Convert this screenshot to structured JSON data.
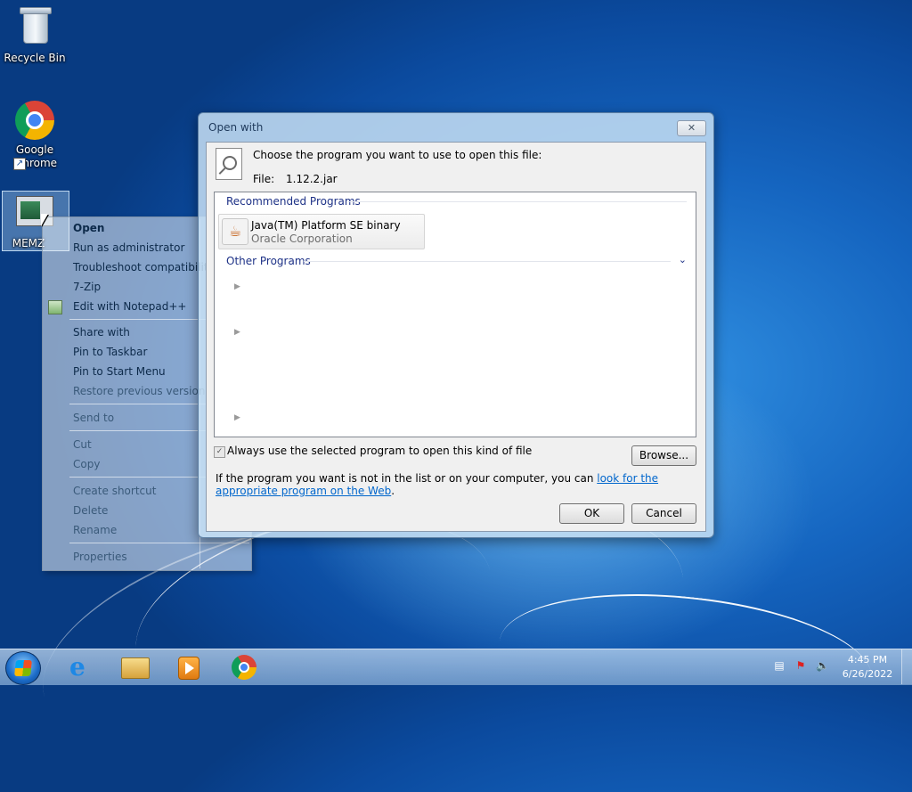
{
  "desktop": {
    "icons": [
      {
        "label": "Recycle Bin"
      },
      {
        "label": "Google Chrome"
      },
      {
        "label": "MEMZ"
      }
    ]
  },
  "context_menu": {
    "items": [
      "Open",
      "Run as administrator",
      "Troubleshoot compatibility",
      "7-Zip",
      "Edit with Notepad++",
      "Share with",
      "Pin to Taskbar",
      "Pin to Start Menu",
      "Restore previous versions",
      "Send to",
      "Cut",
      "Copy",
      "Create shortcut",
      "Delete",
      "Rename",
      "Properties"
    ]
  },
  "dialog": {
    "title": "Open with",
    "close_label": "✕",
    "prompt": "Choose the program you want to use to open this file:",
    "file_label": "File:",
    "file_name": "1.12.2.jar",
    "recommended_header": "Recommended Programs",
    "recommended": [
      {
        "name": "Java(TM) Platform SE binary",
        "publisher": "Oracle Corporation"
      }
    ],
    "other_header": "Other Programs",
    "always_use_checked": true,
    "always_use_label": "Always use the selected program to open this kind of file",
    "browse_label": "Browse...",
    "hint_text": "If the program you want is not in the list or on your computer, you can ",
    "hint_link": "look for the appropriate program on the Web",
    "hint_end": ".",
    "ok_label": "OK",
    "cancel_label": "Cancel"
  },
  "taskbar": {
    "pinned": [
      "internet-explorer",
      "windows-explorer",
      "windows-media-player",
      "google-chrome"
    ],
    "clock_time": "4:45 PM",
    "clock_date": "6/26/2022"
  }
}
